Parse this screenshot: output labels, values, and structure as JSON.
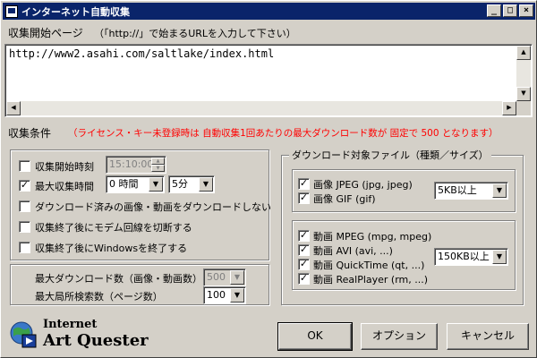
{
  "window": {
    "title": "インターネット自動収集",
    "controls": {
      "minimize": "_",
      "maximize": "□",
      "close": "×"
    }
  },
  "url_section": {
    "label": "収集開始ページ",
    "hint": "（「http://」で始まるURLを入力して下さい）",
    "value": "http://www2.asahi.com/saltlake/index.html"
  },
  "conditions": {
    "label": "収集条件",
    "notice": "（ライセンス・キー未登録時は 自動収集1回あたりの最大ダウンロード数が 固定で 500 となります）",
    "notice_color": "#ff0000",
    "options": [
      {
        "label": "収集開始時刻",
        "checked": false
      },
      {
        "label": "最大収集時間",
        "checked": true
      },
      {
        "label": "ダウンロード済みの画像・動画をダウンロードしない",
        "checked": false
      },
      {
        "label": "収集終了後にモデム回線を切断する",
        "checked": false
      },
      {
        "label": "収集終了後にWindowsを終了する",
        "checked": false
      }
    ],
    "start_time": "15:10:00",
    "max_hours": "0 時間",
    "max_minutes": "5分",
    "max_download_label": "最大ダウンロード数（画像・動画数）",
    "max_download_value": "500",
    "max_search_label": "最大局所検索数（ページ数）",
    "max_search_value": "100"
  },
  "file_types": {
    "label": "ダウンロード対象ファイル（種類／サイズ）",
    "images": [
      {
        "label": "画像 JPEG (jpg, jpeg)",
        "checked": true
      },
      {
        "label": "画像 GIF (gif)",
        "checked": true
      }
    ],
    "image_size": "5KB以上",
    "videos": [
      {
        "label": "動画 MPEG (mpg, mpeg)",
        "checked": true
      },
      {
        "label": "動画 AVI (avi, ...)",
        "checked": true
      },
      {
        "label": "動画 QuickTime (qt, ...)",
        "checked": true
      },
      {
        "label": "動画 RealPlayer (rm, ...)",
        "checked": true
      }
    ],
    "video_size": "150KB以上"
  },
  "logo": {
    "line1": "Internet",
    "line2": "Art Quester"
  },
  "buttons": {
    "ok": "OK",
    "options": "オプション",
    "cancel": "キャンセル"
  },
  "check_mark": "✓"
}
